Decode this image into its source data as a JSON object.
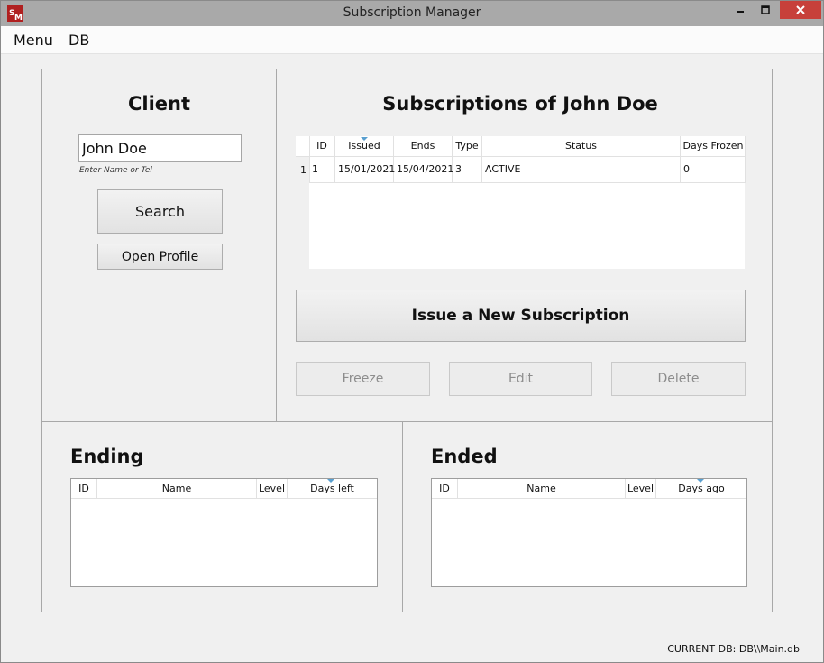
{
  "window": {
    "title": "Subscription Manager"
  },
  "menu": {
    "items": [
      "Menu",
      "DB"
    ]
  },
  "client": {
    "heading": "Client",
    "name_value": "John Doe",
    "hint": "Enter Name or Tel",
    "search_label": "Search",
    "open_profile_label": "Open Profile"
  },
  "subscriptions": {
    "heading": "Subscriptions of John Doe",
    "columns": [
      "ID",
      "Issued",
      "Ends",
      "Type",
      "Status",
      "Days Frozen"
    ],
    "rows": [
      {
        "row_header": "1",
        "id": "1",
        "issued": "15/01/2021",
        "ends": "15/04/2021",
        "type": "3",
        "status": "ACTIVE",
        "days_frozen": "0"
      }
    ],
    "issue_label": "Issue a New Subscription",
    "freeze_label": "Freeze",
    "edit_label": "Edit",
    "delete_label": "Delete"
  },
  "ending": {
    "heading": "Ending",
    "columns": [
      "ID",
      "Name",
      "Level",
      "Days left"
    ]
  },
  "ended": {
    "heading": "Ended",
    "columns": [
      "ID",
      "Name",
      "Level",
      "Days ago"
    ]
  },
  "status_bar": {
    "text": "CURRENT DB: DB\\\\Main.db"
  },
  "colors": {
    "close_button": "#c7403a",
    "sort_indicator": "#5aa0d0",
    "titlebar": "#a9a9a9"
  },
  "icons": [
    "app-icon",
    "minimize-icon",
    "maximize-icon",
    "close-icon",
    "sort-indicator-icon"
  ]
}
